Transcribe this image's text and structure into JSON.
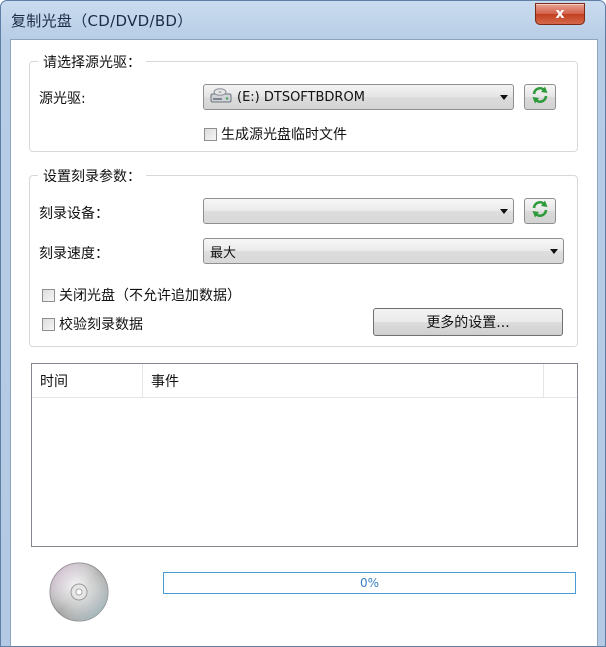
{
  "window": {
    "title": "复制光盘（CD/DVD/BD）",
    "close_label": "x"
  },
  "source": {
    "group_title": "请选择源光驱：",
    "drive_label": "源光驱:",
    "drive_value": "(E:) DTSOFTBDROM",
    "temp_checkbox_label": "生成源光盘临时文件",
    "temp_checked": false
  },
  "burn": {
    "group_title": "设置刻录参数：",
    "device_label": "刻录设备：",
    "device_value": "",
    "speed_label": "刻录速度：",
    "speed_value": "最大",
    "close_disc_label": "关闭光盘（不允许追加数据）",
    "close_disc_checked": false,
    "verify_label": "校验刻录数据",
    "verify_checked": false,
    "more_settings_label": "更多的设置..."
  },
  "log": {
    "columns": [
      "时间",
      "事件"
    ],
    "rows": []
  },
  "progress": {
    "value": 0,
    "text": "0%"
  },
  "icons": {
    "drive": "optical-drive-icon",
    "refresh": "refresh-icon",
    "disc": "cd-disc-icon"
  }
}
